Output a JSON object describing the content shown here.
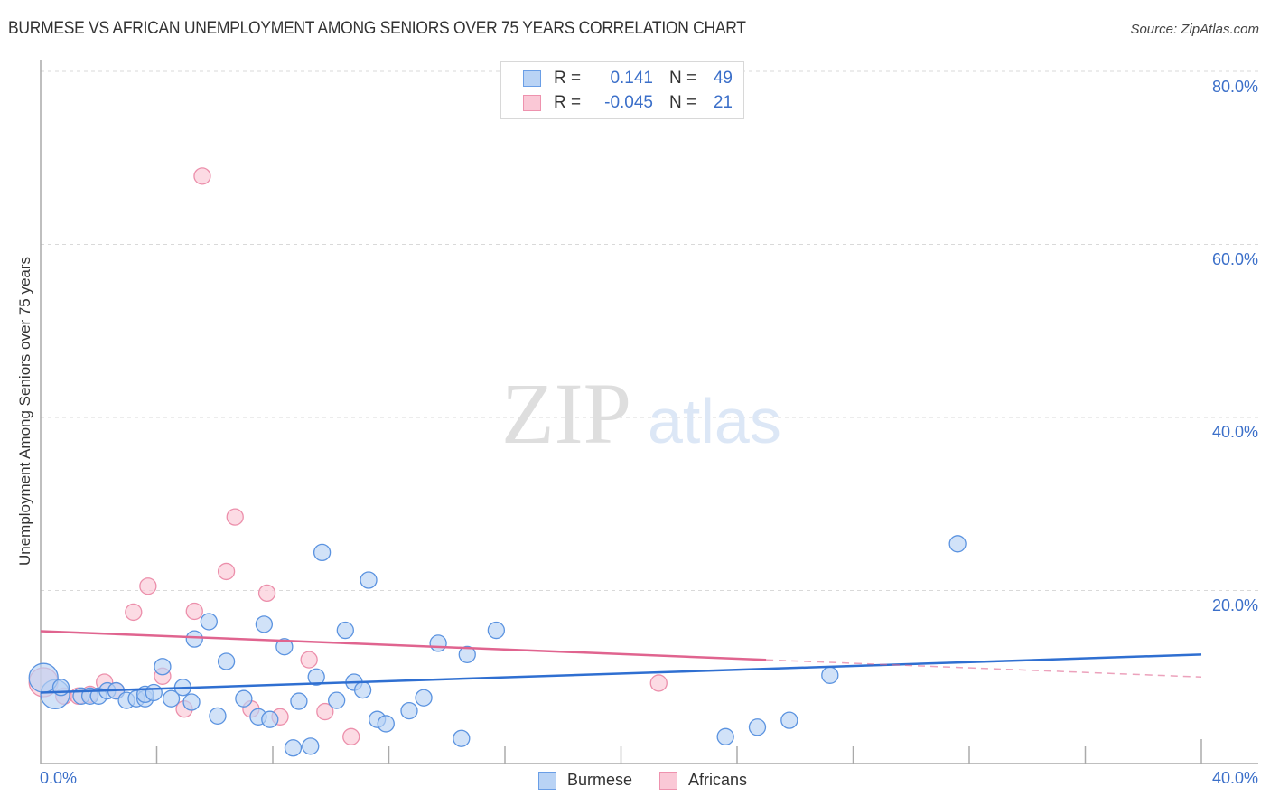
{
  "header": {
    "title": "BURMESE VS AFRICAN UNEMPLOYMENT AMONG SENIORS OVER 75 YEARS CORRELATION CHART",
    "source": "Source: ZipAtlas.com"
  },
  "watermark": {
    "zip": "ZIP",
    "atlas": "atlas"
  },
  "legend": {
    "rows": [
      {
        "r_label": "R =",
        "r_value": "0.141",
        "n_label": "N =",
        "n_value": "49",
        "color_fill": "#b9d3f5",
        "color_stroke": "#6a9ee6"
      },
      {
        "r_label": "R =",
        "r_value": "-0.045",
        "n_label": "N =",
        "n_value": "21",
        "color_fill": "#fac8d6",
        "color_stroke": "#ee92ae"
      }
    ]
  },
  "bottom_legend": [
    {
      "label": "Burmese",
      "color_fill": "#b9d3f5",
      "color_stroke": "#6a9ee6"
    },
    {
      "label": "Africans",
      "color_fill": "#fac8d6",
      "color_stroke": "#ee92ae"
    }
  ],
  "chart_data": {
    "type": "scatter",
    "title": "BURMESE VS AFRICAN UNEMPLOYMENT AMONG SENIORS OVER 75 YEARS CORRELATION CHART",
    "xlabel": "",
    "ylabel": "Unemployment Among Seniors over 75 years",
    "xlim": [
      0,
      40
    ],
    "ylim": [
      0,
      80
    ],
    "x_tick_labels": [
      "0.0%",
      "40.0%"
    ],
    "y_ticks": [
      20,
      40,
      60,
      80
    ],
    "y_tick_labels": [
      "20.0%",
      "40.0%",
      "60.0%",
      "80.0%"
    ],
    "grid": true,
    "legend_position": "top-center",
    "colors": {
      "burmese": "#2f6fd1",
      "africans": "#e0648f",
      "tick_text": "#3b6fc9"
    },
    "series": [
      {
        "name": "Burmese",
        "r": 0.141,
        "n": 49,
        "trend": {
          "x0": 0,
          "y0": 8.2,
          "x1": 40,
          "y1": 12.6,
          "solid_until": 40
        },
        "points": [
          {
            "x": 0.5,
            "y": 8.0,
            "big": true
          },
          {
            "x": 0.1,
            "y": 9.9,
            "big": true
          },
          {
            "x": 0.7,
            "y": 8.8
          },
          {
            "x": 1.4,
            "y": 7.8
          },
          {
            "x": 1.7,
            "y": 7.8
          },
          {
            "x": 2.0,
            "y": 7.8
          },
          {
            "x": 2.3,
            "y": 8.4
          },
          {
            "x": 2.6,
            "y": 8.4
          },
          {
            "x": 2.96,
            "y": 7.3
          },
          {
            "x": 3.3,
            "y": 7.5
          },
          {
            "x": 3.6,
            "y": 7.5
          },
          {
            "x": 3.6,
            "y": 8.0
          },
          {
            "x": 3.9,
            "y": 8.2
          },
          {
            "x": 4.2,
            "y": 11.2
          },
          {
            "x": 4.5,
            "y": 7.5
          },
          {
            "x": 4.9,
            "y": 8.8
          },
          {
            "x": 5.2,
            "y": 7.1
          },
          {
            "x": 5.3,
            "y": 14.4
          },
          {
            "x": 5.8,
            "y": 16.4
          },
          {
            "x": 6.1,
            "y": 5.5
          },
          {
            "x": 6.4,
            "y": 11.8
          },
          {
            "x": 7.0,
            "y": 7.5
          },
          {
            "x": 7.5,
            "y": 5.4
          },
          {
            "x": 7.7,
            "y": 16.1
          },
          {
            "x": 7.9,
            "y": 5.1
          },
          {
            "x": 8.4,
            "y": 13.5
          },
          {
            "x": 8.7,
            "y": 1.8
          },
          {
            "x": 8.9,
            "y": 7.2
          },
          {
            "x": 9.3,
            "y": 2.0
          },
          {
            "x": 9.5,
            "y": 10.0
          },
          {
            "x": 9.7,
            "y": 24.4
          },
          {
            "x": 10.2,
            "y": 7.3
          },
          {
            "x": 10.5,
            "y": 15.4
          },
          {
            "x": 10.8,
            "y": 9.4
          },
          {
            "x": 11.1,
            "y": 8.5
          },
          {
            "x": 11.3,
            "y": 21.2
          },
          {
            "x": 11.6,
            "y": 5.1
          },
          {
            "x": 11.9,
            "y": 4.6
          },
          {
            "x": 12.7,
            "y": 6.1
          },
          {
            "x": 13.2,
            "y": 7.6
          },
          {
            "x": 13.7,
            "y": 13.9
          },
          {
            "x": 14.5,
            "y": 2.9
          },
          {
            "x": 14.7,
            "y": 12.6
          },
          {
            "x": 15.7,
            "y": 15.4
          },
          {
            "x": 23.6,
            "y": 3.1
          },
          {
            "x": 24.7,
            "y": 4.2
          },
          {
            "x": 25.8,
            "y": 5.0
          },
          {
            "x": 27.2,
            "y": 10.2
          },
          {
            "x": 31.6,
            "y": 25.4
          }
        ]
      },
      {
        "name": "Africans",
        "r": -0.045,
        "n": 21,
        "trend": {
          "x0": 0,
          "y0": 15.3,
          "x1": 40,
          "y1": 10.0,
          "solid_until": 25.0
        },
        "points": [
          {
            "x": 0.1,
            "y": 9.4,
            "big": true
          },
          {
            "x": 0.8,
            "y": 7.8
          },
          {
            "x": 1.3,
            "y": 7.8
          },
          {
            "x": 1.7,
            "y": 8.0
          },
          {
            "x": 2.2,
            "y": 9.4
          },
          {
            "x": 2.6,
            "y": 8.4
          },
          {
            "x": 3.2,
            "y": 17.5
          },
          {
            "x": 3.7,
            "y": 20.5
          },
          {
            "x": 4.2,
            "y": 10.1
          },
          {
            "x": 4.95,
            "y": 6.3
          },
          {
            "x": 5.3,
            "y": 17.6
          },
          {
            "x": 5.57,
            "y": 67.9
          },
          {
            "x": 6.4,
            "y": 22.2
          },
          {
            "x": 6.7,
            "y": 28.5
          },
          {
            "x": 7.25,
            "y": 6.3
          },
          {
            "x": 7.8,
            "y": 19.7
          },
          {
            "x": 8.25,
            "y": 5.4
          },
          {
            "x": 9.25,
            "y": 12.0
          },
          {
            "x": 9.8,
            "y": 6.0
          },
          {
            "x": 10.7,
            "y": 3.1
          },
          {
            "x": 21.3,
            "y": 9.3
          }
        ]
      }
    ]
  }
}
